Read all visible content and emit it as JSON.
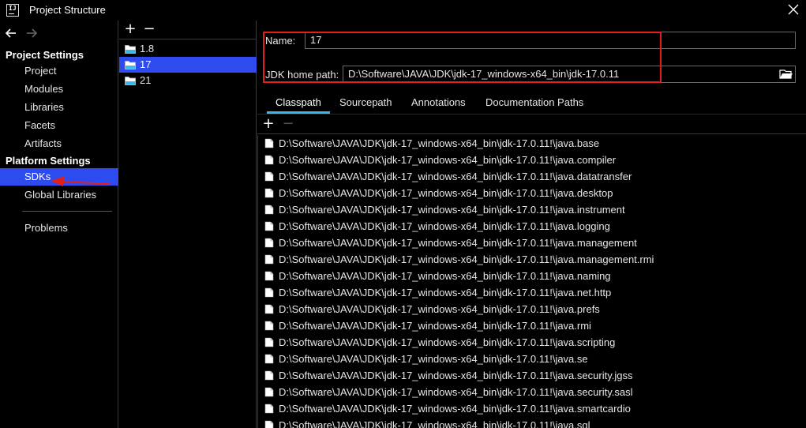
{
  "window": {
    "title": "Project Structure"
  },
  "nav": {
    "project_settings_header": "Project Settings",
    "project_items": [
      "Project",
      "Modules",
      "Libraries",
      "Facets",
      "Artifacts"
    ],
    "platform_settings_header": "Platform Settings",
    "platform_items": [
      "SDKs",
      "Global Libraries"
    ],
    "selected": "SDKs",
    "other_items": [
      "Problems"
    ]
  },
  "sdk_list": {
    "add_icon": "+",
    "remove_icon": "−",
    "items": [
      "1.8",
      "17",
      "21"
    ],
    "selected": "17"
  },
  "sdk_detail": {
    "name_label": "Name:",
    "name_value": "17",
    "home_label": "JDK home path:",
    "home_value": "D:\\Software\\JAVA\\JDK\\jdk-17_windows-x64_bin\\jdk-17.0.11",
    "tabs": [
      "Classpath",
      "Sourcepath",
      "Annotations",
      "Documentation Paths"
    ],
    "active_tab": "Classpath",
    "path_add_icon": "+",
    "path_remove_icon": "−",
    "classpath": [
      "D:\\Software\\JAVA\\JDK\\jdk-17_windows-x64_bin\\jdk-17.0.11!\\java.base",
      "D:\\Software\\JAVA\\JDK\\jdk-17_windows-x64_bin\\jdk-17.0.11!\\java.compiler",
      "D:\\Software\\JAVA\\JDK\\jdk-17_windows-x64_bin\\jdk-17.0.11!\\java.datatransfer",
      "D:\\Software\\JAVA\\JDK\\jdk-17_windows-x64_bin\\jdk-17.0.11!\\java.desktop",
      "D:\\Software\\JAVA\\JDK\\jdk-17_windows-x64_bin\\jdk-17.0.11!\\java.instrument",
      "D:\\Software\\JAVA\\JDK\\jdk-17_windows-x64_bin\\jdk-17.0.11!\\java.logging",
      "D:\\Software\\JAVA\\JDK\\jdk-17_windows-x64_bin\\jdk-17.0.11!\\java.management",
      "D:\\Software\\JAVA\\JDK\\jdk-17_windows-x64_bin\\jdk-17.0.11!\\java.management.rmi",
      "D:\\Software\\JAVA\\JDK\\jdk-17_windows-x64_bin\\jdk-17.0.11!\\java.naming",
      "D:\\Software\\JAVA\\JDK\\jdk-17_windows-x64_bin\\jdk-17.0.11!\\java.net.http",
      "D:\\Software\\JAVA\\JDK\\jdk-17_windows-x64_bin\\jdk-17.0.11!\\java.prefs",
      "D:\\Software\\JAVA\\JDK\\jdk-17_windows-x64_bin\\jdk-17.0.11!\\java.rmi",
      "D:\\Software\\JAVA\\JDK\\jdk-17_windows-x64_bin\\jdk-17.0.11!\\java.scripting",
      "D:\\Software\\JAVA\\JDK\\jdk-17_windows-x64_bin\\jdk-17.0.11!\\java.se",
      "D:\\Software\\JAVA\\JDK\\jdk-17_windows-x64_bin\\jdk-17.0.11!\\java.security.jgss",
      "D:\\Software\\JAVA\\JDK\\jdk-17_windows-x64_bin\\jdk-17.0.11!\\java.security.sasl",
      "D:\\Software\\JAVA\\JDK\\jdk-17_windows-x64_bin\\jdk-17.0.11!\\java.smartcardio",
      "D:\\Software\\JAVA\\JDK\\jdk-17_windows-x64_bin\\jdk-17.0.11!\\java.sql"
    ]
  },
  "colors": {
    "selection": "#2e4bf0",
    "tab_underline": "#3ab8e8",
    "annotation_red": "#e02020"
  }
}
